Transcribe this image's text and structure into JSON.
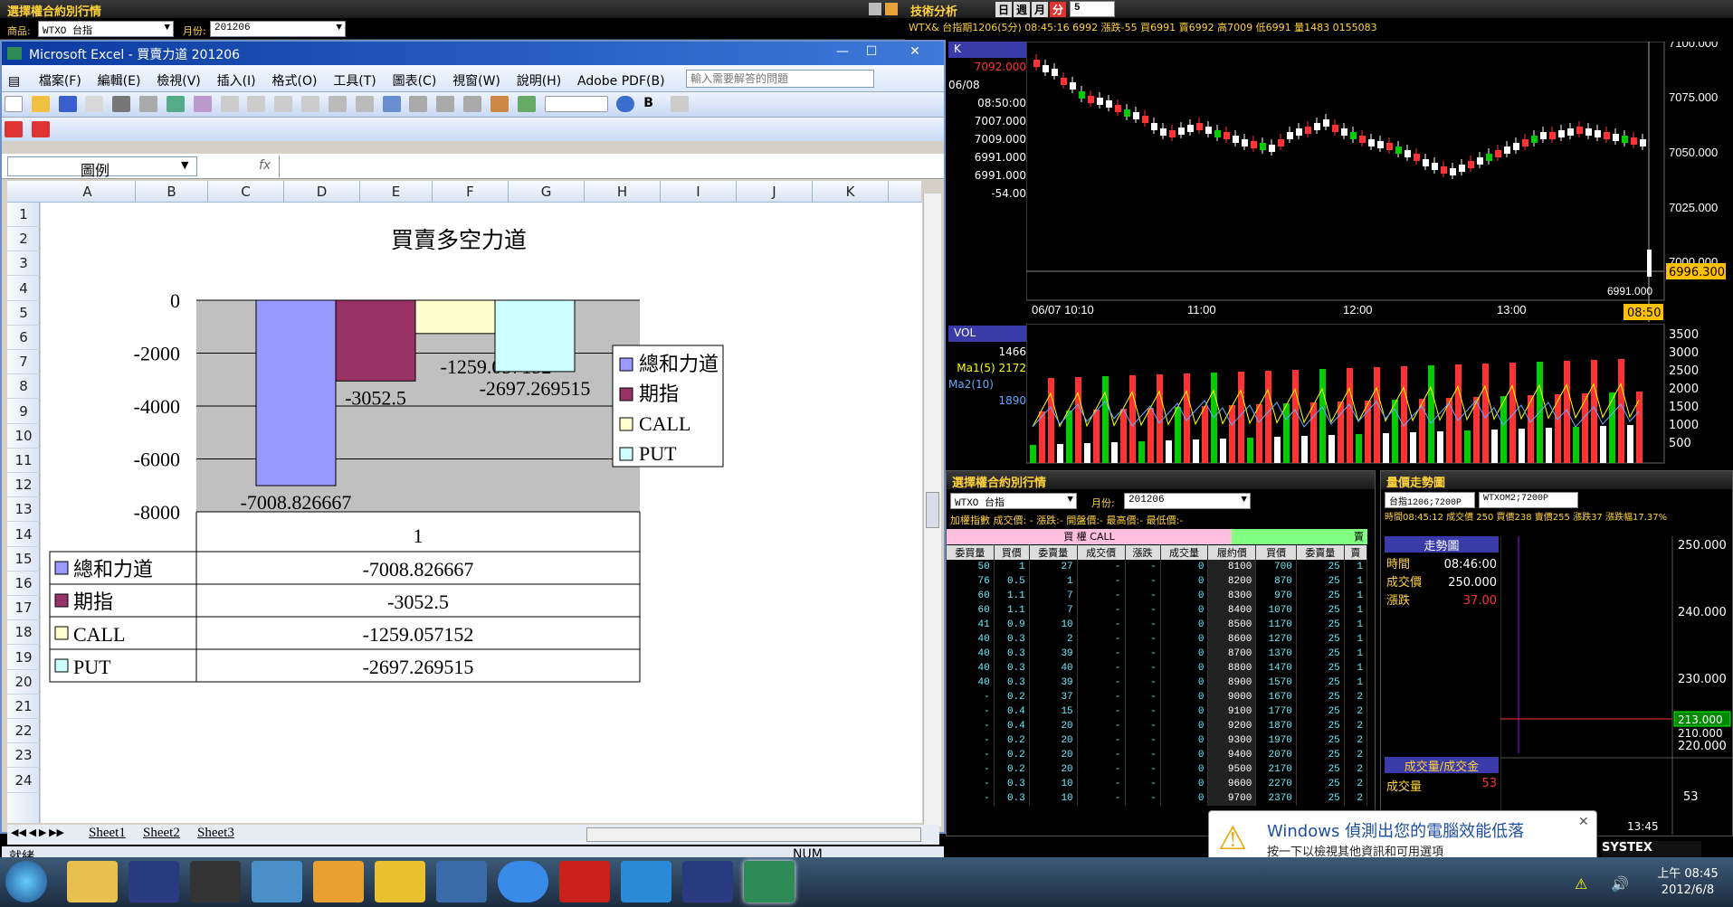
{
  "opt_top": {
    "title": "選擇權合約別行情",
    "product_label": "商品:",
    "product_value": "WTXO 台指",
    "month_label": "月份:",
    "month_value": "201206"
  },
  "excel": {
    "title": "Microsoft Excel - 買賣力道 201206",
    "menu": [
      "檔案(F)",
      "編輯(E)",
      "檢視(V)",
      "插入(I)",
      "格式(O)",
      "工具(T)",
      "圖表(C)",
      "視窗(W)",
      "說明(H)",
      "Adobe PDF(B)"
    ],
    "help_placeholder": "輸入需要解答的問題",
    "name_box": "圖例",
    "fx": "fx",
    "columns": [
      "A",
      "B",
      "C",
      "D",
      "E",
      "F",
      "G",
      "H",
      "I",
      "J",
      "K"
    ],
    "rows": [
      "1",
      "2",
      "3",
      "4",
      "5",
      "6",
      "7",
      "8",
      "9",
      "10",
      "11",
      "12",
      "13",
      "14",
      "15",
      "16",
      "17",
      "18",
      "19",
      "20",
      "21",
      "22",
      "23",
      "24"
    ],
    "sheet_tabs": [
      "Sheet1",
      "Sheet2",
      "Sheet3"
    ],
    "status_left": "就緒",
    "status_num": "NUM"
  },
  "chart_data": {
    "type": "bar",
    "title": "買賣多空力道",
    "categories": [
      "1"
    ],
    "series": [
      {
        "name": "總和力道",
        "values": [
          -7008.826667
        ],
        "label": "-7008.826667",
        "color": "#9999ff"
      },
      {
        "name": "期指",
        "values": [
          -3052.5
        ],
        "label": "-3052.5",
        "color": "#993366"
      },
      {
        "name": "CALL",
        "values": [
          -1259.057152
        ],
        "label": "-1259.057152",
        "color": "#ffffcc"
      },
      {
        "name": "PUT",
        "values": [
          -2697.269515
        ],
        "label": "-2697.269515",
        "color": "#ccffff"
      }
    ],
    "yticks": [
      "0",
      "-2000",
      "-4000",
      "-6000",
      "-8000"
    ],
    "ylim": [
      -8000,
      0
    ],
    "grid": true,
    "legend": "right",
    "plot_bg": "#c0c0c0"
  },
  "tech": {
    "title": "技術分析",
    "period_options": [
      "日",
      "週",
      "月",
      "分"
    ],
    "period_value": "5",
    "info": "WTX& 台指期1206(5分) 08:45:16  6992 漲跌-55 買6991 賣6992 高7009 低6991 量1483 0155083",
    "k_label": "K",
    "k_values": [
      "7092.000",
      "06/08",
      "08:50:00",
      "7007.000",
      "7009.000",
      "6991.000",
      "6991.000",
      "-54.00"
    ],
    "price_axis": [
      "7100.000",
      "7075.000",
      "7050.000",
      "7025.000",
      "7000.000"
    ],
    "last_price": "6996.300",
    "time_axis": [
      "06/07 10:10",
      "11:00",
      "12:00",
      "13:00"
    ],
    "time_marker": "08:50",
    "low_label": "6991.000",
    "vol_label": "VOL",
    "vol_values": [
      "1466",
      "Ma1(5) 2172",
      "Ma2(10)",
      "1890"
    ],
    "vol_axis": [
      "3500",
      "3000",
      "2500",
      "2000",
      "1500",
      "1000",
      "500"
    ]
  },
  "opt_bottom": {
    "title": "選擇權合約別行情",
    "product_value": "WTXO 台指",
    "month_label": "月份:",
    "month_value": "201206",
    "fields": "加權指數  成交價:  -  漲跌:-  開盤價:-  最高價:-  最低價:-",
    "call_header": "買   權 CALL",
    "put_header": "賣",
    "headers": [
      "委買量",
      "買價",
      "委賣量",
      "成交價",
      "漲跌",
      "成交量",
      "履約價",
      "買價",
      "委賣量",
      "賣"
    ],
    "rows": [
      [
        "50",
        "1",
        "27",
        "-",
        "-",
        "0",
        "8100",
        "700",
        "25",
        "1"
      ],
      [
        "76",
        "0.5",
        "1",
        "-",
        "-",
        "0",
        "8200",
        "870",
        "25",
        "1"
      ],
      [
        "60",
        "1.1",
        "7",
        "-",
        "-",
        "0",
        "8300",
        "970",
        "25",
        "1"
      ],
      [
        "60",
        "1.1",
        "7",
        "-",
        "-",
        "0",
        "8400",
        "1070",
        "25",
        "1"
      ],
      [
        "41",
        "0.9",
        "10",
        "-",
        "-",
        "0",
        "8500",
        "1170",
        "25",
        "1"
      ],
      [
        "40",
        "0.3",
        "2",
        "-",
        "-",
        "0",
        "8600",
        "1270",
        "25",
        "1"
      ],
      [
        "40",
        "0.3",
        "39",
        "-",
        "-",
        "0",
        "8700",
        "1370",
        "25",
        "1"
      ],
      [
        "40",
        "0.3",
        "40",
        "-",
        "-",
        "0",
        "8800",
        "1470",
        "25",
        "1"
      ],
      [
        "40",
        "0.3",
        "39",
        "-",
        "-",
        "0",
        "8900",
        "1570",
        "25",
        "1"
      ],
      [
        "-",
        "0.2",
        "37",
        "-",
        "-",
        "0",
        "9000",
        "1670",
        "25",
        "2"
      ],
      [
        "-",
        "0.4",
        "15",
        "-",
        "-",
        "0",
        "9100",
        "1770",
        "25",
        "2"
      ],
      [
        "-",
        "0.4",
        "20",
        "-",
        "-",
        "0",
        "9200",
        "1870",
        "25",
        "2"
      ],
      [
        "-",
        "0.2",
        "20",
        "-",
        "-",
        "0",
        "9300",
        "1970",
        "25",
        "2"
      ],
      [
        "-",
        "0.2",
        "20",
        "-",
        "-",
        "0",
        "9400",
        "2070",
        "25",
        "2"
      ],
      [
        "-",
        "0.2",
        "20",
        "-",
        "-",
        "0",
        "9500",
        "2170",
        "25",
        "2"
      ],
      [
        "-",
        "0.3",
        "10",
        "-",
        "-",
        "0",
        "9600",
        "2270",
        "25",
        "2"
      ],
      [
        "-",
        "0.3",
        "10",
        "-",
        "-",
        "0",
        "9700",
        "2370",
        "25",
        "2"
      ]
    ]
  },
  "trend": {
    "title": "量價走勢圖",
    "product_value": "台指1206;7200P",
    "product2_value": "WTXOM2;7200P",
    "info": "時間08:45:12 成交價 250 買價238 賣價255 漲跌37 漲跌幅17.37%",
    "trend_tab": "走勢圖",
    "time_label": "時間",
    "time_value": "08:46:00",
    "price_label": "成交價",
    "price_value": "250.000",
    "chg_label": "漲跌",
    "chg_value": "37.00",
    "axis": [
      "250.000",
      "240.000",
      "230.000",
      "220.000",
      "210.000"
    ],
    "marker": "213.000",
    "vol_tab": "成交量/成交金",
    "vol_label": "成交量",
    "vol_value": "53",
    "vol_axis": "53",
    "time_end": "13:45"
  },
  "popup": {
    "title": "Windows 偵測出您的電腦效能低落",
    "body": "按一下以檢視其他資訊和可用選項"
  },
  "systex": "SYSTEX",
  "clock": {
    "time": "上午 08:45",
    "date": "2012/6/8"
  }
}
